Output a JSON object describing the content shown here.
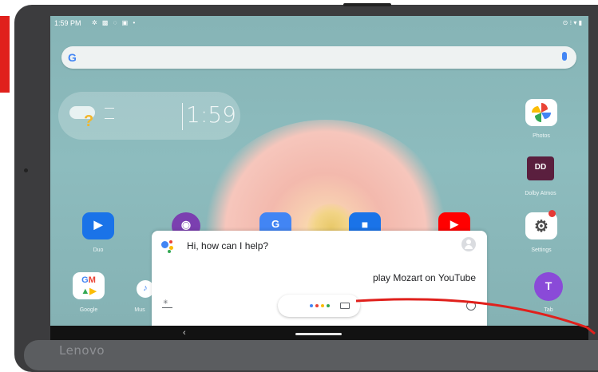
{
  "status_bar": {
    "time": "1:59 PM",
    "icons_text": "✲ ▩ ◌ ▣ •",
    "right_text": "⊙ ⁝ ▾ ▮"
  },
  "search_bar": {
    "logo": "G",
    "mic_icon": "mic-icon"
  },
  "clock_widget": {
    "time": "1:59",
    "weather_icon": "partly-cloudy-icon"
  },
  "apps_right": [
    {
      "label": "Photos",
      "icon": "photos-icon"
    },
    {
      "label": "Dolby Atmos",
      "icon": "dolby-icon"
    },
    {
      "label": "Settings",
      "icon": "gear-icon"
    },
    {
      "label": "Tab",
      "icon": "tab-icon"
    }
  ],
  "apps_row": [
    {
      "label": "Duo",
      "icon": "video-call-icon"
    },
    {
      "label": "Google",
      "icon": "google-apps-icon"
    },
    {
      "label": "Mus",
      "icon": "music-icon"
    }
  ],
  "assistant": {
    "greeting": "Hi, how can I help?",
    "user_query": "play Mozart on YouTube",
    "colors": {
      "blue": "#4285F4",
      "red": "#EA4335",
      "yellow": "#FBBC05",
      "green": "#34A853"
    }
  },
  "device": {
    "brand": "Lenovo"
  },
  "annotation": {
    "color": "#e0201c"
  }
}
